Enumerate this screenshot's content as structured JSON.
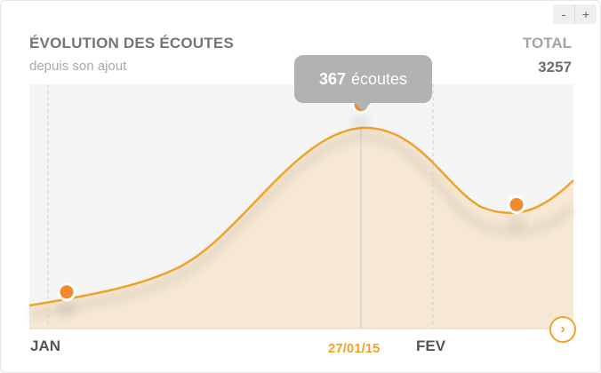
{
  "widget": {
    "title": "ÉVOLUTION DES ÉCOUTES",
    "subtitle": "depuis son ajout",
    "total_label": "TOTAL",
    "total_value": "3257"
  },
  "zoom": {
    "out_label": "-",
    "in_label": "+"
  },
  "tooltip": {
    "value": "367",
    "unit": "écoutes"
  },
  "x_axis": {
    "jan": "JAN",
    "fev": "FEV",
    "selected": "27/01/15"
  },
  "next_icon": "chevron-right-icon",
  "colors": {
    "line": "#f0a32a",
    "point": "#f08a30",
    "area": "#f6e8d4",
    "plot_bg": "#f5f5f5",
    "tooltip_bg": "#b2b2b2"
  },
  "chart_data": {
    "type": "area",
    "x": [
      "JAN",
      "27/01/15",
      "FEV"
    ],
    "marked_points": [
      {
        "y": 60
      },
      {
        "label": "27/01/15",
        "y": 367
      },
      {
        "y": 203
      }
    ],
    "ylim": [
      0,
      400
    ],
    "grid": false
  }
}
